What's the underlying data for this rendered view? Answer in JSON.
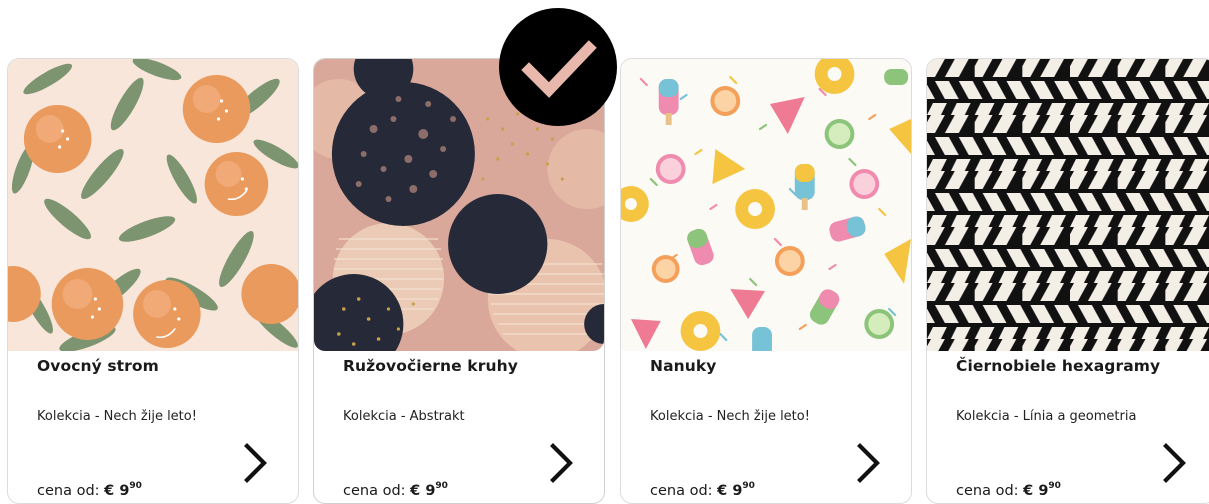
{
  "currency_symbol": "€",
  "price_prefix": "cena od:",
  "cards": [
    {
      "title": "Ovocný strom",
      "collection": "Kolekcia - Nech žije leto!",
      "price_whole": "9",
      "price_cents": "90",
      "selected": false
    },
    {
      "title": "Ružovočierne kruhy",
      "collection": "Kolekcia - Abstrakt",
      "price_whole": "9",
      "price_cents": "90",
      "selected": true
    },
    {
      "title": "Nanuky",
      "collection": "Kolekcia - Nech žije leto!",
      "price_whole": "9",
      "price_cents": "90",
      "selected": false
    },
    {
      "title": "Čiernobiele hexagramy",
      "collection": "Kolekcia - Línia a geometria",
      "price_whole": "9",
      "price_cents": "90",
      "selected": false
    }
  ],
  "colors": {
    "peach_bg": "#f8e6da",
    "peach_fruit": "#ea9a5c",
    "leaf_green": "#7c9470",
    "rose_bg": "#d9a89a",
    "navy": "#262a38",
    "gold": "#c8a04a",
    "cream": "#f5ece1",
    "pattern_black": "#111111",
    "badge_black": "#000000",
    "check_color": "#e8b8ac"
  }
}
